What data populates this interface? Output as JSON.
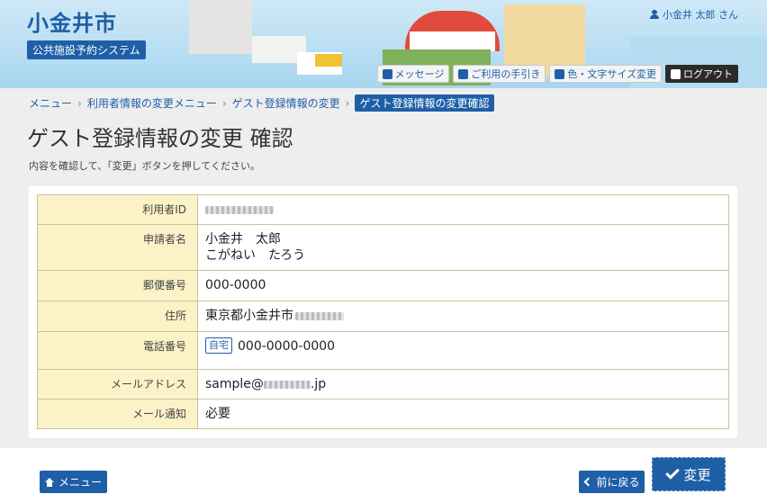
{
  "header": {
    "city_name": "小金井市",
    "system_name": "公共施設予約システム",
    "user_name": "小金井 太郎 さん",
    "toolbar": {
      "message": "メッセージ",
      "guide": "ご利用の手引き",
      "display": "色・文字サイズ変更",
      "logout": "ログアウト"
    }
  },
  "breadcrumb": {
    "items": [
      "メニュー",
      "利用者情報の変更メニュー",
      "ゲスト登録情報の変更"
    ],
    "current": "ゲスト登録情報の変更確認"
  },
  "page": {
    "title": "ゲスト登録情報の変更 確認",
    "instruction": "内容を確認して、「変更」ボタンを押してください。"
  },
  "form": {
    "user_id": {
      "label": "利用者ID"
    },
    "applicant": {
      "label": "申請者名",
      "name": "小金井　太郎",
      "kana": "こがねい　たろう"
    },
    "postal": {
      "label": "郵便番号",
      "value": "000-0000"
    },
    "address": {
      "label": "住所",
      "value": "東京都小金井市"
    },
    "phone": {
      "label": "電話番号",
      "tag": "自宅",
      "value": "000-0000-0000"
    },
    "email": {
      "label": "メールアドレス",
      "prefix": "sample@",
      "suffix": ".jp"
    },
    "notify": {
      "label": "メール通知",
      "value": "必要"
    }
  },
  "footer": {
    "menu": "メニュー",
    "back": "前に戻る",
    "change": "変更"
  }
}
